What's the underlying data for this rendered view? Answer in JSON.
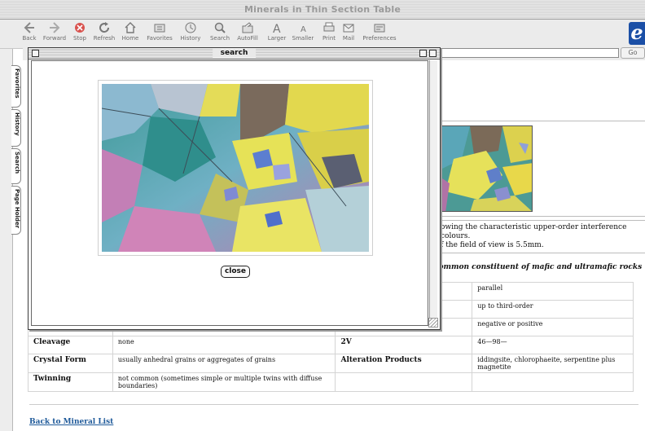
{
  "window": {
    "title": "Minerals in Thin Section Table"
  },
  "toolbar": {
    "buttons": [
      {
        "label": "Back"
      },
      {
        "label": "Forward"
      },
      {
        "label": "Stop"
      },
      {
        "label": "Refresh"
      },
      {
        "label": "Home"
      },
      {
        "label": "Favorites"
      },
      {
        "label": "History"
      },
      {
        "label": "Search"
      },
      {
        "label": "AutoFill"
      },
      {
        "label": "Larger"
      },
      {
        "label": "Smaller"
      },
      {
        "label": "Print"
      },
      {
        "label": "Mail"
      },
      {
        "label": "Preferences"
      }
    ],
    "go_label": "Go"
  },
  "sidebar": {
    "tabs": [
      {
        "label": "Favorites"
      },
      {
        "label": "History"
      },
      {
        "label": "Search"
      },
      {
        "label": "Page Holder"
      }
    ]
  },
  "popup": {
    "title": "search",
    "close_label": "close"
  },
  "page": {
    "caption_line1": "owing the characteristic upper-order interference colours.",
    "caption_line2": "f the field of view is 5.5mm.",
    "heading_note": "a common constituent of mafic and ultramafic rocks",
    "rows": [
      {
        "k1": "",
        "v1": "",
        "k2": "",
        "v2": "parallel"
      },
      {
        "k1": "",
        "v1": "",
        "k2": "",
        "v2": "up to third-order"
      },
      {
        "k1": "",
        "v1": "",
        "k2": "",
        "v2": "negative or positive"
      },
      {
        "k1": "Cleavage",
        "v1": "none",
        "k2": "2V",
        "v2": "46—98—"
      },
      {
        "k1": "Crystal Form",
        "v1": "usually anhedral grains or aggregates of grains",
        "k2": "Alteration Products",
        "v2": "iddingsite, chlorophaeite, serpentine plus magnetite"
      },
      {
        "k1": "Twinning",
        "v1": "not common (sometimes simple or multiple twins with diffuse boundaries)",
        "k2": "",
        "v2": ""
      }
    ],
    "back_link": "Back to Mineral List"
  }
}
